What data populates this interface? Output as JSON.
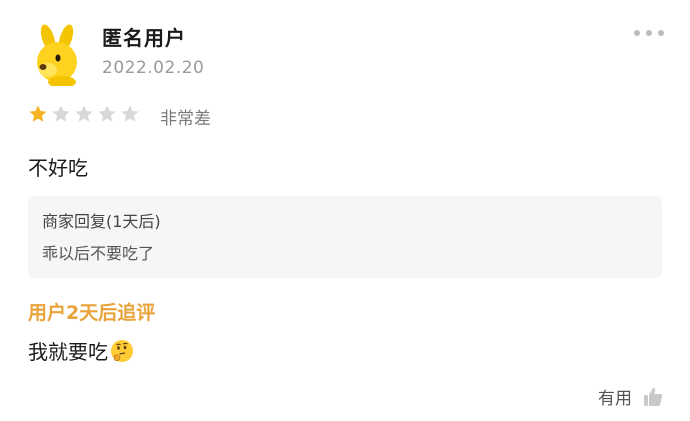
{
  "user": {
    "name": "匿名用户",
    "date": "2022.02.20"
  },
  "rating": {
    "filled": 1,
    "total": 5,
    "label": "非常差",
    "star_color": "#f5b324",
    "empty_color": "#d8d8d8"
  },
  "review": {
    "text": "不好吃"
  },
  "merchant_reply": {
    "title": "商家回复(1天后)",
    "text": "乖以后不要吃了"
  },
  "followup": {
    "title": "用户2天后追评",
    "text": "我就要吃",
    "emoji_icon": "thinking-face-icon",
    "accent": "#e8a33a"
  },
  "actions": {
    "useful_label": "有用",
    "useful_icon": "thumbs-up-icon",
    "more_icon": "more-dots-icon"
  }
}
